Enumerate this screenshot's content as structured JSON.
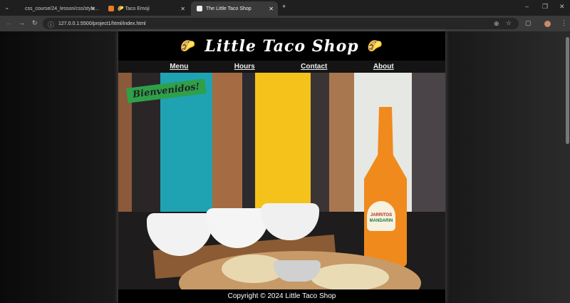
{
  "browser": {
    "tabs": [
      {
        "label": "css_course/24_lesson/css/style..."
      },
      {
        "label": "🌮 Taco Emoji"
      },
      {
        "label": "The Little Taco Shop"
      }
    ],
    "url": "127.0.0.1:5500/project1/html/index.html"
  },
  "site": {
    "title": "Little Taco Shop",
    "logo_emoji": "🌮",
    "nav": [
      {
        "label": "Menu"
      },
      {
        "label": "Hours"
      },
      {
        "label": "Contact"
      },
      {
        "label": "About"
      }
    ],
    "hero_badge": "Bienvenidos!",
    "bottle_label": "JARRITOS",
    "bottle_flavor": "MANDARIN",
    "footer": "Copyright © 2024 Little Taco Shop"
  }
}
